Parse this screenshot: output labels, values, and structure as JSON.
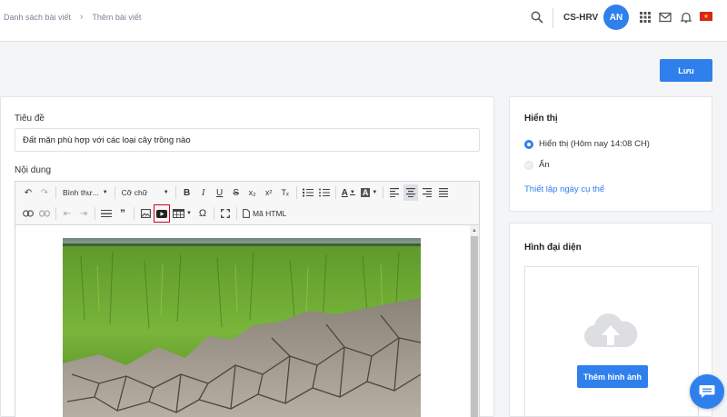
{
  "breadcrumb": {
    "items": [
      "Danh sách bài viết",
      "Thêm bài viết"
    ]
  },
  "header": {
    "store_name": "CS-HRV",
    "avatar_initials": "AN"
  },
  "toolbar": {
    "save_label": "Lưu"
  },
  "form": {
    "title_label": "Tiêu đề",
    "title_value": "Đất mặn phù hợp với các loại cây trồng nào",
    "content_label": "Nội dung"
  },
  "editor": {
    "format_select": "Bình thư...",
    "size_select": "Cỡ chữ",
    "html_button": "Mã HTML",
    "selected_tool": "insert-video"
  },
  "visibility": {
    "title": "Hiển thị",
    "option_show": "Hiển thị (Hôm nay 14:08 CH)",
    "option_hide": "Ẩn",
    "selected": "show",
    "schedule_link": "Thiết lập ngày cụ thể"
  },
  "featured_image": {
    "title": "Hình đại diện",
    "upload_button": "Thêm hình ảnh"
  },
  "colors": {
    "accent": "#2f80ed",
    "highlight_border": "#d0021b"
  }
}
